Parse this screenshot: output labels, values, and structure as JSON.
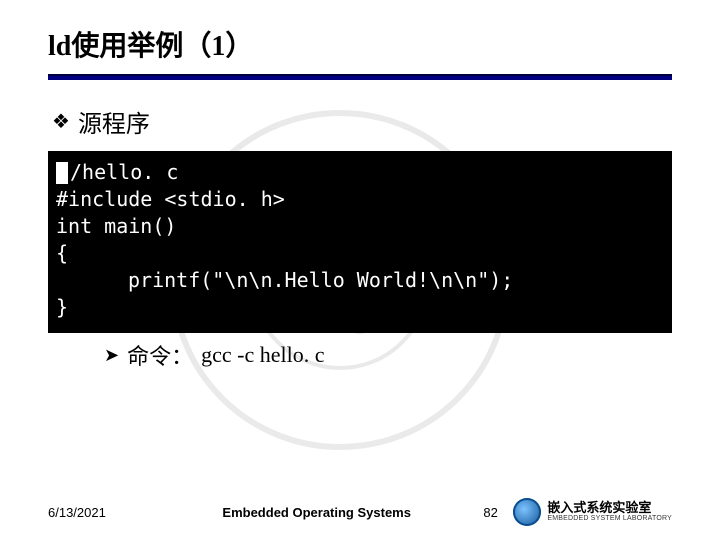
{
  "title": "ld使用举例（1）",
  "bullets": {
    "main": "源程序"
  },
  "code": {
    "l1": "/hello. c",
    "l2": "",
    "l3": "#include <stdio. h>",
    "l4": "int main()",
    "l5": "{",
    "l6": "printf(\"\\n\\n.Hello World!\\n\\n\");",
    "l7": "}"
  },
  "sub_bullet": {
    "label": "命令：",
    "cmd": "gcc -c hello. c"
  },
  "footer": {
    "date": "6/13/2021",
    "center": "Embedded Operating Systems",
    "page": "82",
    "lab_cn": "嵌入式系统实验室",
    "lab_en": "EMBEDDED SYSTEM LABORATORY"
  }
}
